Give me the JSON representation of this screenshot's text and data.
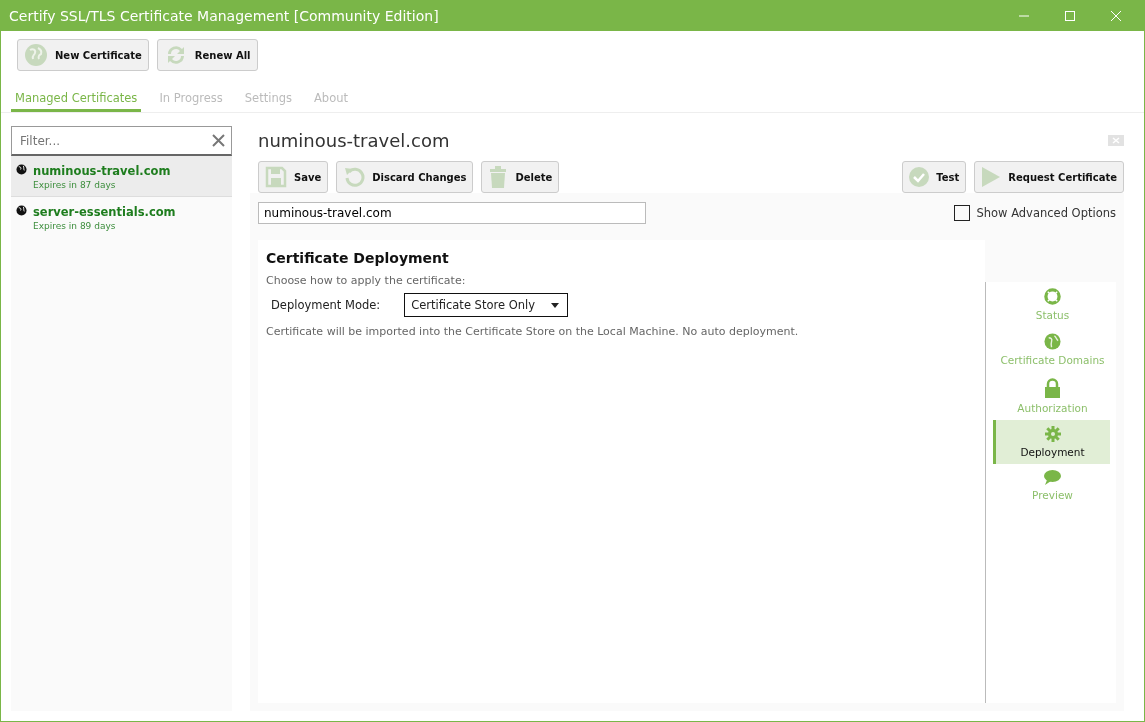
{
  "window": {
    "title": "Certify SSL/TLS Certificate Management [Community Edition]"
  },
  "toolbar": [
    "New Certificate",
    "Renew All"
  ],
  "tabs": [
    {
      "label": "Managed Certificates",
      "selected": true
    },
    {
      "label": "In Progress",
      "selected": false
    },
    {
      "label": "Settings",
      "selected": false
    },
    {
      "label": "About",
      "selected": false
    }
  ],
  "filter": {
    "placeholder": "Filter..."
  },
  "certificates": [
    {
      "name": "numinous-travel.com",
      "expiry": "Expires in 87 days",
      "selected": true
    },
    {
      "name": "server-essentials.com",
      "expiry": "Expires in 89 days",
      "selected": false
    }
  ],
  "detail": {
    "title": "numinous-travel.com",
    "actions_left": [
      "Save",
      "Discard Changes",
      "Delete"
    ],
    "actions_right": [
      "Test",
      "Request Certificate"
    ],
    "name_value": "numinous-travel.com",
    "show_advanced": {
      "label": "Show Advanced Options",
      "checked": false
    },
    "section": {
      "heading": "Certificate Deployment",
      "intro": "Choose how to apply the certificate:",
      "mode_label": "Deployment Mode:",
      "mode_value": "Certificate Store Only",
      "note": "Certificate will be imported into the Certificate Store on the Local Machine. No auto deployment."
    },
    "nav": [
      {
        "label": "Status",
        "selected": false
      },
      {
        "label": "Certificate Domains",
        "selected": false
      },
      {
        "label": "Authorization",
        "selected": false
      },
      {
        "label": "Deployment",
        "selected": true
      },
      {
        "label": "Preview",
        "selected": false
      }
    ]
  }
}
